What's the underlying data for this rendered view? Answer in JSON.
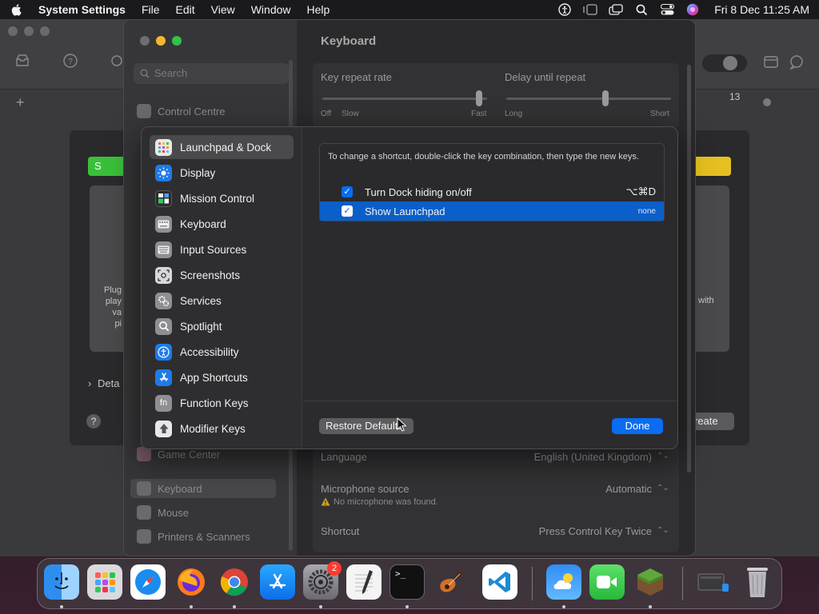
{
  "menubar": {
    "app_name": "System Settings",
    "menus": [
      "File",
      "Edit",
      "View",
      "Window",
      "Help"
    ],
    "clock": "Fri 8 Dec  11:25 AM"
  },
  "background_window": {
    "left_text": "Plug\nplay\nva\npi",
    "right_text": "with",
    "details_label": "Deta",
    "create_label": "reate",
    "help_label": "?",
    "ruler_number": "13",
    "add_label": "+",
    "green_label": "S"
  },
  "settings": {
    "title": "Keyboard",
    "search_placeholder": "Search",
    "sidebar_items": [
      "Control Centre",
      "Game Center",
      "Keyboard",
      "Mouse",
      "Printers & Scanners"
    ],
    "key_repeat_rate": {
      "label": "Key repeat rate",
      "min": "Off",
      "min2": "Slow",
      "max": "Fast",
      "level": 0.95
    },
    "delay_until_repeat": {
      "label": "Delay until repeat",
      "min": "Long",
      "max": "Short",
      "level": 0.6
    },
    "language": {
      "label": "Language",
      "value": "English (United Kingdom)"
    },
    "microphone": {
      "label": "Microphone source",
      "value": "Automatic",
      "warning": "No microphone was found."
    },
    "shortcut": {
      "label": "Shortcut",
      "value": "Press Control Key Twice"
    },
    "stepper_glyph": "⌃⌄"
  },
  "sheet": {
    "categories": [
      {
        "label": "Launchpad & Dock",
        "icon": "launchpad-icon",
        "color": "#e8e8ea",
        "selected": true
      },
      {
        "label": "Display",
        "icon": "sun-icon",
        "color": "#1f7ae8"
      },
      {
        "label": "Mission Control",
        "icon": "mission-control-icon",
        "color": "#2c2c2e"
      },
      {
        "label": "Keyboard",
        "icon": "keyboard-icon",
        "color": "#8e8e93"
      },
      {
        "label": "Input Sources",
        "icon": "input-sources-icon",
        "color": "#8e8e93"
      },
      {
        "label": "Screenshots",
        "icon": "screenshot-icon",
        "color": "#d8d8da"
      },
      {
        "label": "Services",
        "icon": "gear-icon",
        "color": "#8e8e93"
      },
      {
        "label": "Spotlight",
        "icon": "magnifier-icon",
        "color": "#8e8e93"
      },
      {
        "label": "Accessibility",
        "icon": "accessibility-icon",
        "color": "#1f7ae8"
      },
      {
        "label": "App Shortcuts",
        "icon": "app-store-icon",
        "color": "#1f7ae8"
      },
      {
        "label": "Function Keys",
        "icon": "fn-icon",
        "color": "#8e8e93",
        "glyph": "fn"
      },
      {
        "label": "Modifier Keys",
        "icon": "up-arrow-icon",
        "color": "#e8e8ea"
      }
    ],
    "hint": "To change a shortcut, double-click the key combination, then type the new keys.",
    "shortcuts": [
      {
        "label": "Turn Dock hiding on/off",
        "key": "⌥⌘D",
        "checked": true,
        "selected": false
      },
      {
        "label": "Show Launchpad",
        "key": "none",
        "checked": true,
        "selected": true
      }
    ],
    "check_glyph": "✓",
    "restore_label": "Restore Defaults",
    "done_label": "Done"
  },
  "dock": {
    "apps": [
      "finder",
      "launchpad",
      "safari",
      "firefox",
      "chrome",
      "app-store",
      "system-settings",
      "textedit",
      "terminal",
      "garageband",
      "vscode",
      "weather",
      "facetime",
      "minecraft",
      "screenshot-preview",
      "trash"
    ],
    "settings_badge": "2",
    "terminal_prompt": ">_"
  }
}
